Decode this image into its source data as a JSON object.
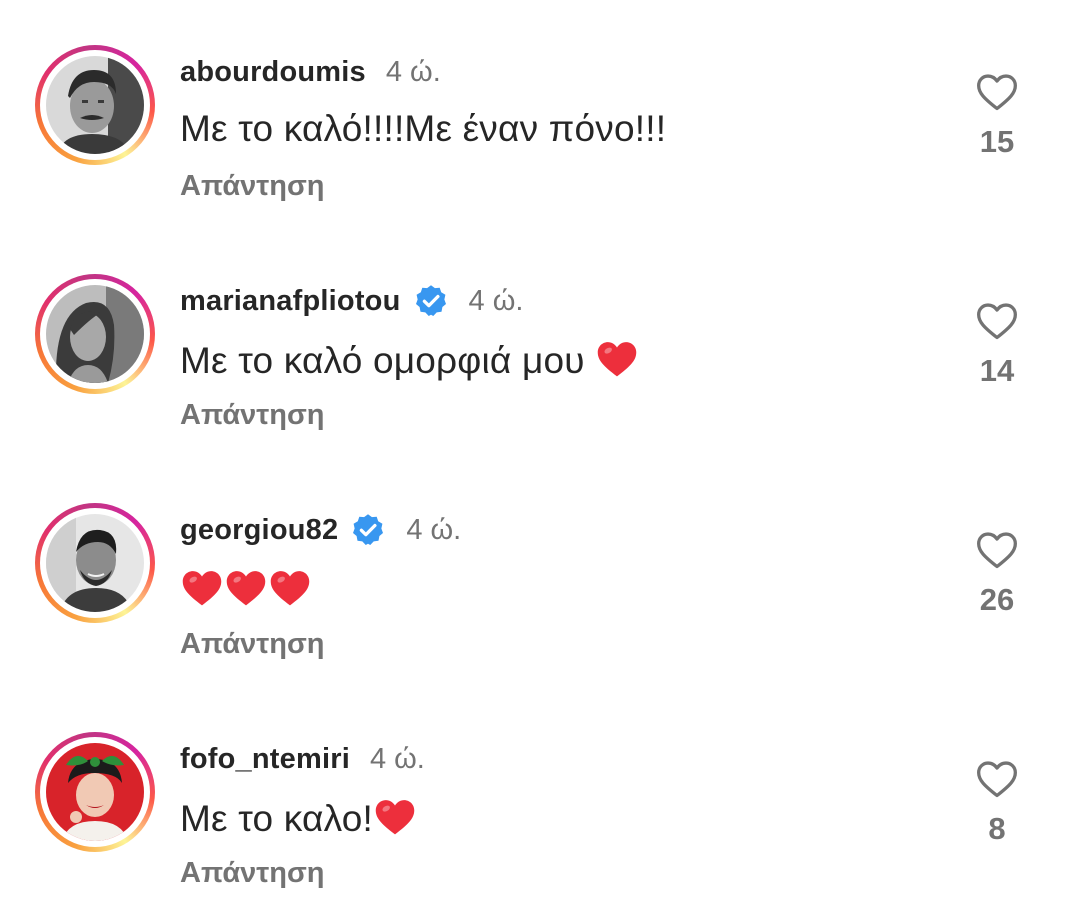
{
  "comments": [
    {
      "username": "abourdoumis",
      "verified": false,
      "time": "4 ώ.",
      "text": "Με το καλό!!!!Με έναν πόνο!!!",
      "reply_label": "Απάντηση",
      "likes": "15",
      "avatar_icon": "avatar-man-mustache"
    },
    {
      "username": "marianafpliotou",
      "verified": true,
      "time": "4 ώ.",
      "text": "Με το καλό ομορφιά μου ❤️",
      "reply_label": "Απάντηση",
      "likes": "14",
      "avatar_icon": "avatar-woman"
    },
    {
      "username": "georgiou82",
      "verified": true,
      "time": "4 ώ.",
      "text": "❤️❤️❤️",
      "reply_label": "Απάντηση",
      "likes": "26",
      "avatar_icon": "avatar-man-smiling"
    },
    {
      "username": "fofo_ntemiri",
      "verified": false,
      "time": "4 ώ.",
      "text": "Με το καλο!❤️",
      "reply_label": "Απάντηση",
      "likes": "8",
      "avatar_icon": "avatar-woman-red-background"
    }
  ],
  "colors": {
    "verified_badge": "#3897f0",
    "heart_red": "#ed2f3c",
    "secondary_text": "#737373",
    "primary_text": "#262626"
  }
}
